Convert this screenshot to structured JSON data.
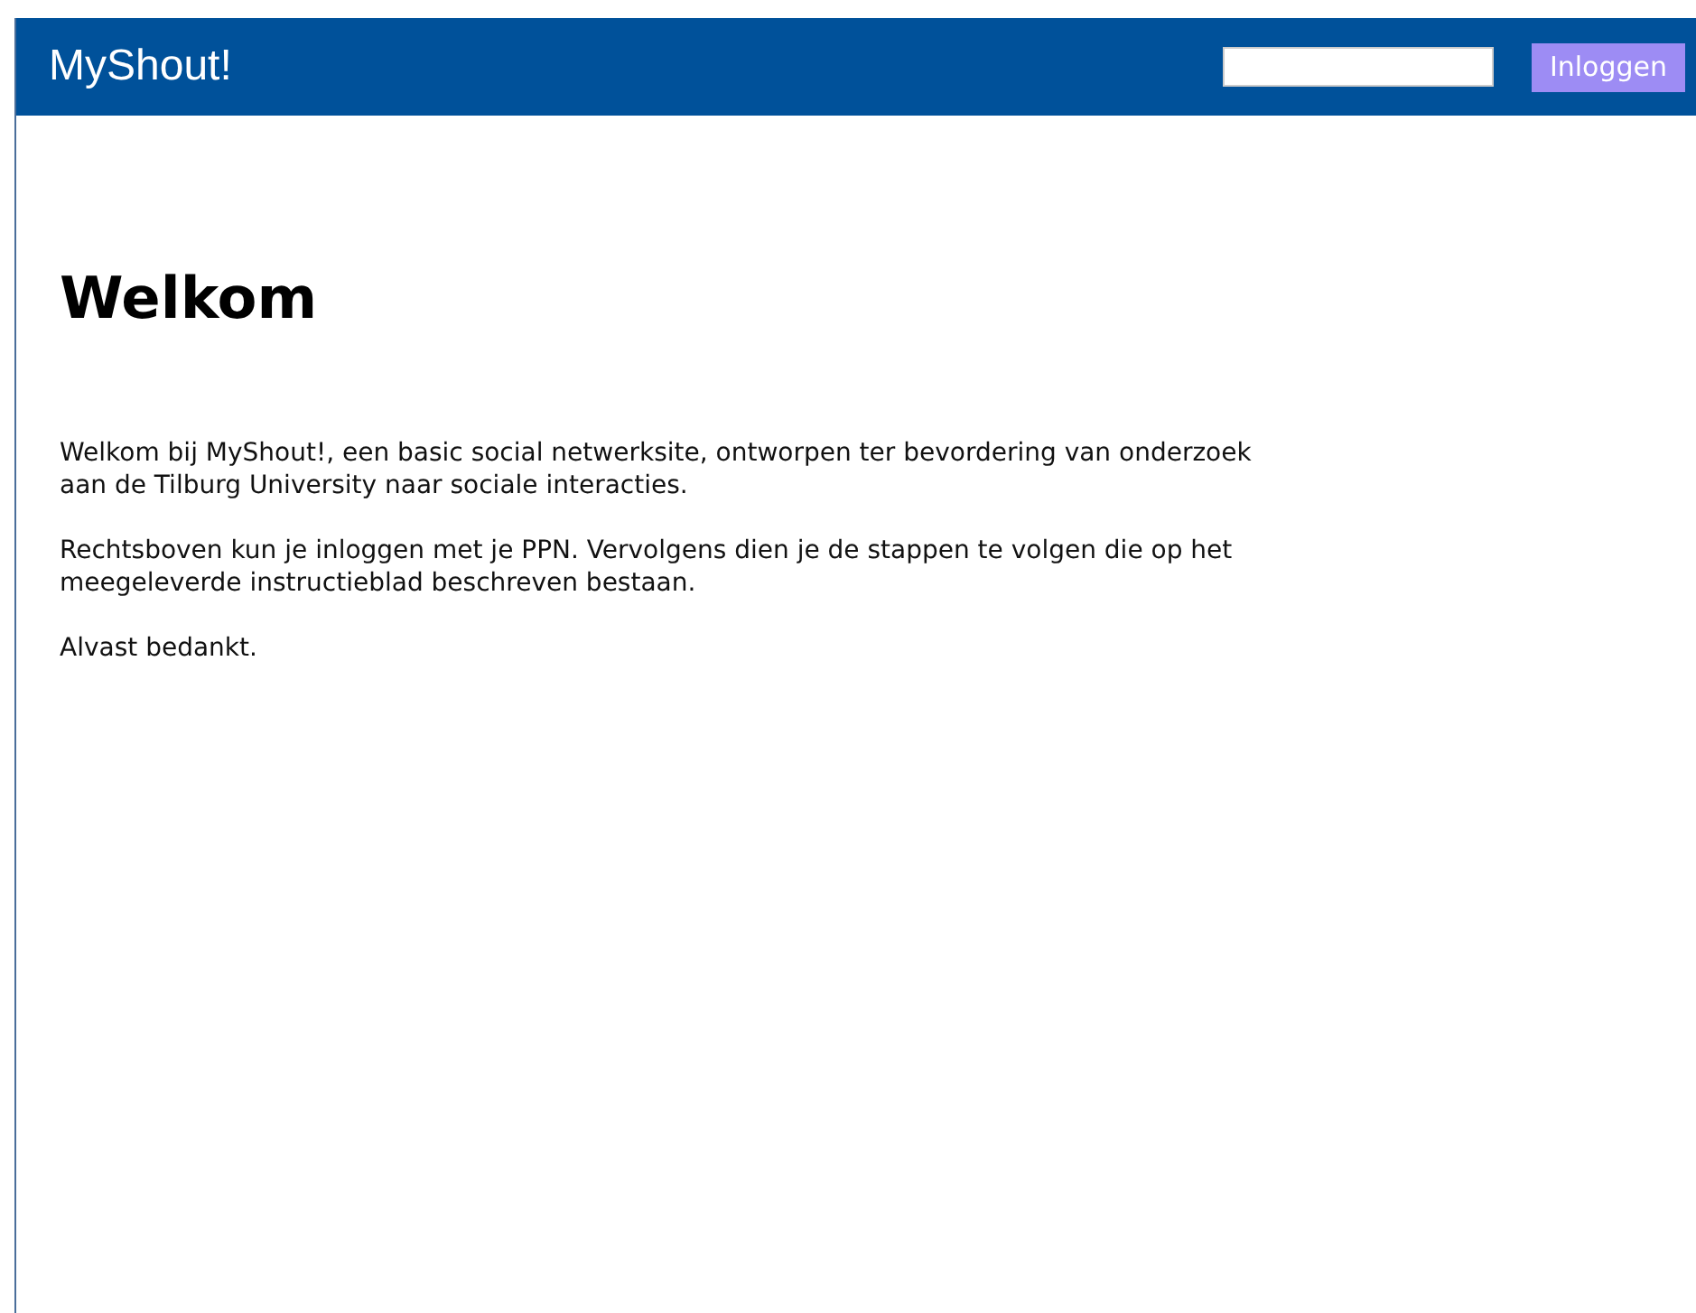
{
  "header": {
    "title": "MyShout!",
    "login_button": "Inloggen"
  },
  "heading": "Welkom",
  "paragraphs": [
    "Welkom bij MyShout!, een basic social netwerksite, ontworpen ter bevordering van onderzoek aan de Tilburg University naar sociale interacties.",
    "Rechtsboven kun je inloggen met je PPN. Vervolgens dien je de stappen te volgen die op het meegeleverde instructieblad beschreven bestaan.",
    "Alvast bedankt."
  ]
}
